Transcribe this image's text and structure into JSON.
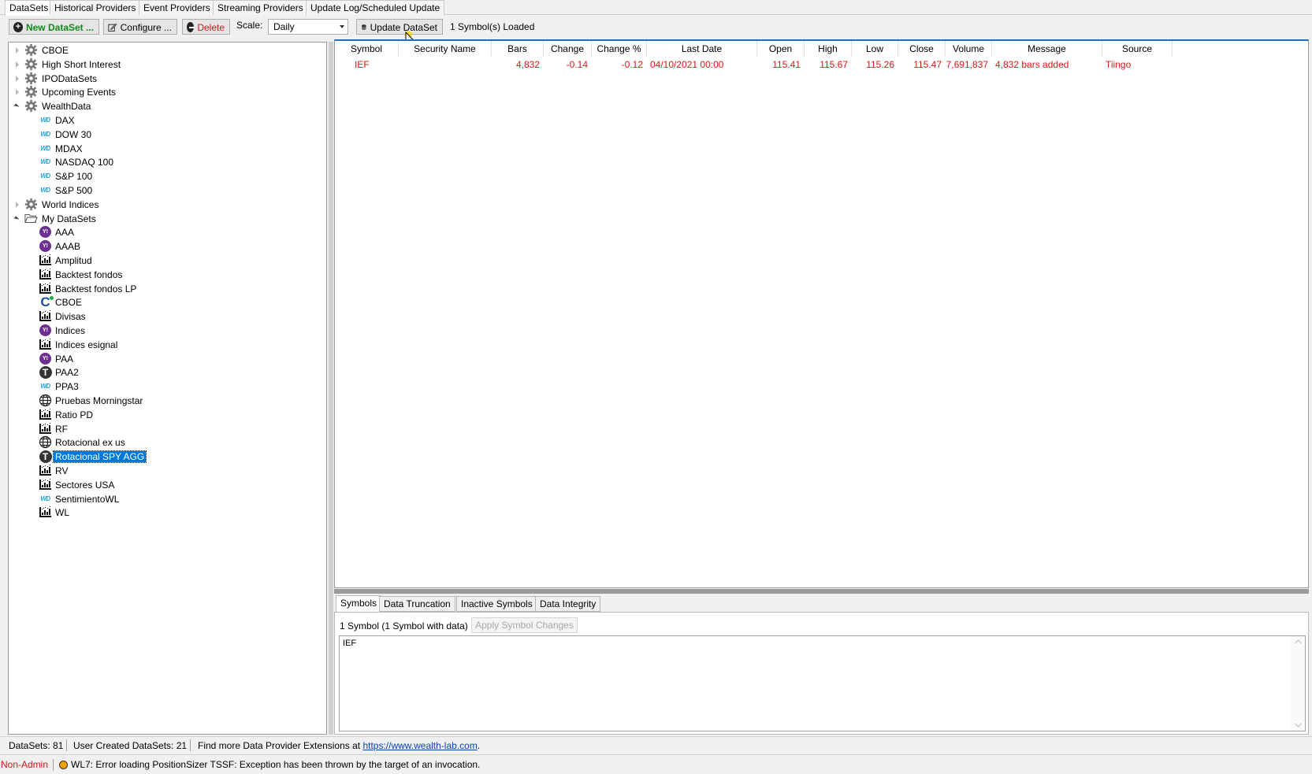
{
  "top_tabs": [
    "DataSets",
    "Historical Providers",
    "Event Providers",
    "Streaming Providers",
    "Update Log/Scheduled Update"
  ],
  "toolbar": {
    "new_dataset_label": "New DataSet ...",
    "configure_label": "Configure ...",
    "delete_label": "Delete",
    "scale_label": "Scale:",
    "scale_value": "Daily",
    "update_label": "Update DataSet",
    "status": "1 Symbol(s) Loaded"
  },
  "tree": {
    "groups": [
      {
        "label": "CBOE",
        "expanded": false,
        "icon": "gear-icon"
      },
      {
        "label": "High Short Interest",
        "expanded": false,
        "icon": "gear-icon"
      },
      {
        "label": "IPODataSets",
        "expanded": false,
        "icon": "gear-icon"
      },
      {
        "label": "Upcoming Events",
        "expanded": false,
        "icon": "gear-icon"
      },
      {
        "label": "WealthData",
        "expanded": true,
        "icon": "gear-icon"
      },
      {
        "label": "World Indices",
        "expanded": false,
        "icon": "gear-icon"
      },
      {
        "label": "My DataSets",
        "expanded": true,
        "icon": "folder-icon"
      }
    ],
    "wealthdata_children": [
      {
        "label": "DAX",
        "icon": "wd-icon"
      },
      {
        "label": "DOW 30",
        "icon": "wd-icon"
      },
      {
        "label": "MDAX",
        "icon": "wd-icon"
      },
      {
        "label": "NASDAQ 100",
        "icon": "wd-icon"
      },
      {
        "label": "S&P 100",
        "icon": "wd-icon"
      },
      {
        "label": "S&P 500",
        "icon": "wd-icon"
      }
    ],
    "my_datasets_children": [
      {
        "label": "AAA",
        "icon": "yahoo-icon"
      },
      {
        "label": "AAAB",
        "icon": "yahoo-icon"
      },
      {
        "label": "Amplitud",
        "icon": "chart-icon"
      },
      {
        "label": "Backtest fondos",
        "icon": "chart-icon"
      },
      {
        "label": "Backtest fondos LP",
        "icon": "chart-icon"
      },
      {
        "label": "CBOE",
        "icon": "cboe-icon"
      },
      {
        "label": "Divisas",
        "icon": "chart-icon"
      },
      {
        "label": "Indices",
        "icon": "yahoo-icon"
      },
      {
        "label": "Indices esignal",
        "icon": "chart-icon"
      },
      {
        "label": "PAA",
        "icon": "yahoo-icon"
      },
      {
        "label": "PAA2",
        "icon": "tiingo-icon"
      },
      {
        "label": "PPA3",
        "icon": "wd-icon"
      },
      {
        "label": "Pruebas Morningstar",
        "icon": "globe-icon"
      },
      {
        "label": "Ratio PD",
        "icon": "chart-icon"
      },
      {
        "label": "RF",
        "icon": "chart-icon"
      },
      {
        "label": "Rotacional ex us",
        "icon": "globe-icon"
      },
      {
        "label": "Rotacional SPY AGG",
        "icon": "tiingo-icon",
        "selected": true
      },
      {
        "label": "RV",
        "icon": "chart-icon"
      },
      {
        "label": "Sectores USA",
        "icon": "chart-icon"
      },
      {
        "label": "SentimientoWL",
        "icon": "wd-icon"
      },
      {
        "label": "WL",
        "icon": "chart-icon"
      }
    ],
    "wd_icon_text": "WD",
    "yahoo_icon_text": "Y!",
    "tiingo_icon_text": "T",
    "cboe_icon_text": "C"
  },
  "grid": {
    "columns": [
      "Symbol",
      "Security Name",
      "Bars",
      "Change",
      "Change %",
      "Last Date",
      "Open",
      "High",
      "Low",
      "Close",
      "Volume",
      "Message",
      "Source"
    ],
    "rows": [
      {
        "symbol": "IEF",
        "security_name": "",
        "bars": "4,832",
        "change": "-0.14",
        "change_pct": "-0.12",
        "last_date": "04/10/2021 00:00",
        "open": "115.41",
        "high": "115.67",
        "low": "115.26",
        "close": "115.47",
        "volume": "7,691,837",
        "message": "4,832 bars added",
        "source": "Tiingo"
      }
    ],
    "row_color": "#e11414"
  },
  "bottom_tabs": [
    "Symbols",
    "Data Truncation",
    "Inactive Symbols",
    "Data Integrity"
  ],
  "symbols_panel": {
    "count_text": "1 Symbol (1 Symbol with data)",
    "apply_label": "Apply Symbol Changes",
    "symbols_text": "IEF"
  },
  "status1": {
    "datasets": "DataSets: 81",
    "user_created": "User Created DataSets: 21",
    "find_more": "Find more Data Provider Extensions at ",
    "link": "https://www.wealth-lab.com",
    "link_suffix": "."
  },
  "status2": {
    "role": "Non-Admin",
    "error": "WL7: Error loading PositionSizer TSSF: Exception has been thrown by the target of an invocation."
  }
}
